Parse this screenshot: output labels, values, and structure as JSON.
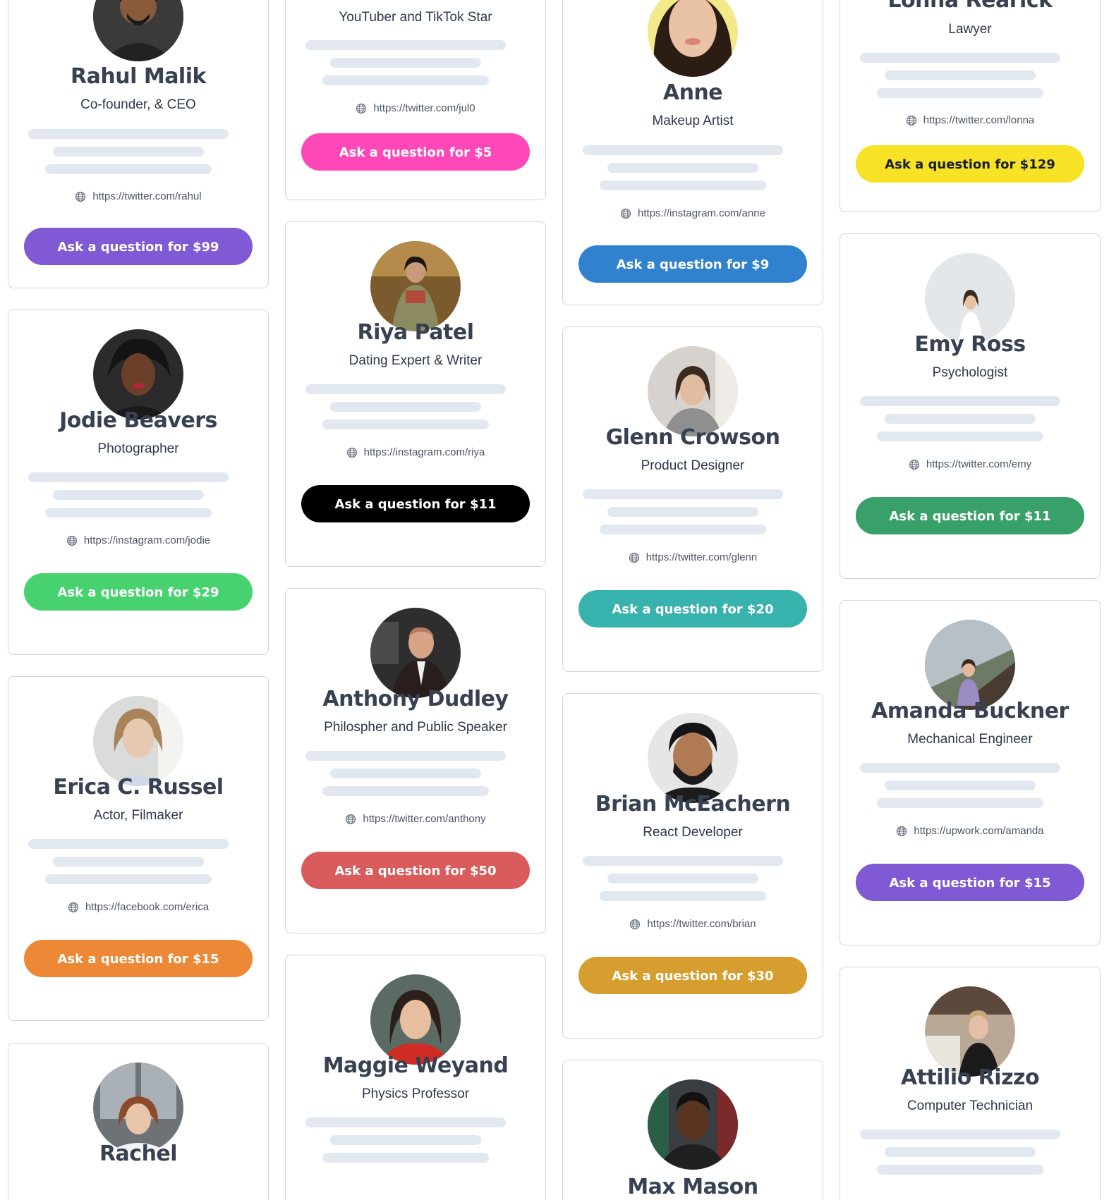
{
  "cards": [
    {
      "name": "Rahul Malik",
      "role": "Co-founder, & CEO",
      "link": "https://twitter.com/rahul",
      "button": "Ask a question for $99",
      "color": "#805ad5"
    },
    {
      "name": "Jodie Beavers",
      "role": "Photographer",
      "link": "https://instagram.com/jodie",
      "button": "Ask a question for $29",
      "color": "#48d16f"
    },
    {
      "name": "Erica C. Russel",
      "role": "Actor, Filmaker",
      "link": "https://facebook.com/erica",
      "button": "Ask a question for $15",
      "color": "#ed8936"
    },
    {
      "name": "Rachel",
      "role": "",
      "link": "",
      "button": "",
      "color": ""
    },
    {
      "name": "",
      "role": "YouTuber and TikTok Star",
      "link": "https://twitter.com/jul0",
      "button": "Ask a question for $5",
      "color": "#ff48b8"
    },
    {
      "name": "Riya Patel",
      "role": "Dating Expert & Writer",
      "link": "https://instagram.com/riya",
      "button": "Ask a question for $11",
      "color": "#000000"
    },
    {
      "name": "Anthony Dudley",
      "role": "Philospher and Public Speaker",
      "link": "https://twitter.com/anthony",
      "button": "Ask a question for $50",
      "color": "#da5b5b"
    },
    {
      "name": "Maggie Weyand",
      "role": "Physics Professor",
      "link": "",
      "button": "",
      "color": ""
    },
    {
      "name": "Anne",
      "role": "Makeup Artist",
      "link": "https://instagram.com/anne",
      "button": "Ask a question for $9",
      "color": "#3182ce"
    },
    {
      "name": "Glenn Crowson",
      "role": "Product Designer",
      "link": "https://twitter.com/glenn",
      "button": "Ask a question for $20",
      "color": "#38b2ac"
    },
    {
      "name": "Brian McEachern",
      "role": "React Developer",
      "link": "https://twitter.com/brian",
      "button": "Ask a question for $30",
      "color": "#d69e2e"
    },
    {
      "name": "Max Mason",
      "role": "",
      "link": "",
      "button": "",
      "color": ""
    },
    {
      "name": "Lonna Rearick",
      "role": "Lawyer",
      "link": "https://twitter.com/lonna",
      "button": "Ask a question for $129",
      "color": "#f7e225"
    },
    {
      "name": "Emy Ross",
      "role": "Psychologist",
      "link": "https://twitter.com/emy",
      "button": "Ask a question for $11",
      "color": "#38a169"
    },
    {
      "name": "Amanda Buckner",
      "role": "Mechanical Engineer",
      "link": "https://upwork.com/amanda",
      "button": "Ask a question for $15",
      "color": "#805ad5"
    },
    {
      "name": "Attilio Rizzo",
      "role": "Computer Technician",
      "link": "",
      "button": "",
      "color": ""
    }
  ],
  "avatar_colors": {
    "rahul": {
      "bg": "#3a3a3a",
      "skin": "#8a5a3c",
      "hair": "#1a1a1a",
      "shirt": "#222222"
    },
    "jodie": {
      "bg": "#2b2b2b",
      "skin": "#6b3f2a",
      "hair": "#141414",
      "shirt": "#1a1a1a"
    },
    "erica": {
      "bg": "#d9dcd8",
      "skin": "#e7c9b2",
      "hair": "#a9835a",
      "shirt": "#cfd8e6"
    },
    "rachel": {
      "bg": "#6d7277",
      "skin": "#e8c4a8",
      "hair": "#8b4a2b",
      "shirt": "#f5f5f5"
    },
    "riya": {
      "bg": "#7b5b2e",
      "skin": "#c99a78",
      "hair": "#1d1410",
      "shirt": "#8c8a60"
    },
    "anthony": {
      "bg": "#2e2e2e",
      "skin": "#d7a488",
      "hair": "#b07d63",
      "shirt": "#2a1d1d"
    },
    "maggie": {
      "bg": "#5b6a63",
      "skin": "#e7bfa0",
      "hair": "#2a1f1a",
      "shirt": "#d12b26"
    },
    "anne": {
      "bg": "#f2e98a",
      "skin": "#eac3a6",
      "hair": "#2b1c14",
      "shirt": "#eac3a6"
    },
    "glenn": {
      "bg": "#d7d2cd",
      "skin": "#e2bca1",
      "hair": "#3a2a20",
      "shirt": "#8f8f8f"
    },
    "brian": {
      "bg": "#e6e6e6",
      "skin": "#b07a55",
      "hair": "#141414",
      "shirt": "#1c1c1c"
    },
    "max": {
      "bg": "#3a3d42",
      "skin": "#5a3420",
      "hair": "#121212",
      "shirt": "#202020"
    },
    "emy": {
      "bg": "#e4e7ea",
      "skin": "#e7c1a2",
      "hair": "#3b2a1f",
      "shirt": "#ffffff"
    },
    "amanda": {
      "bg": "#6c7a66",
      "skin": "#e2b898",
      "hair": "#3a2a1f",
      "shirt": "#9b8cc2"
    },
    "attilio": {
      "bg": "#b8a895",
      "skin": "#e3c0a5",
      "hair": "#c8a77a",
      "shirt": "#1b1b1b"
    }
  }
}
